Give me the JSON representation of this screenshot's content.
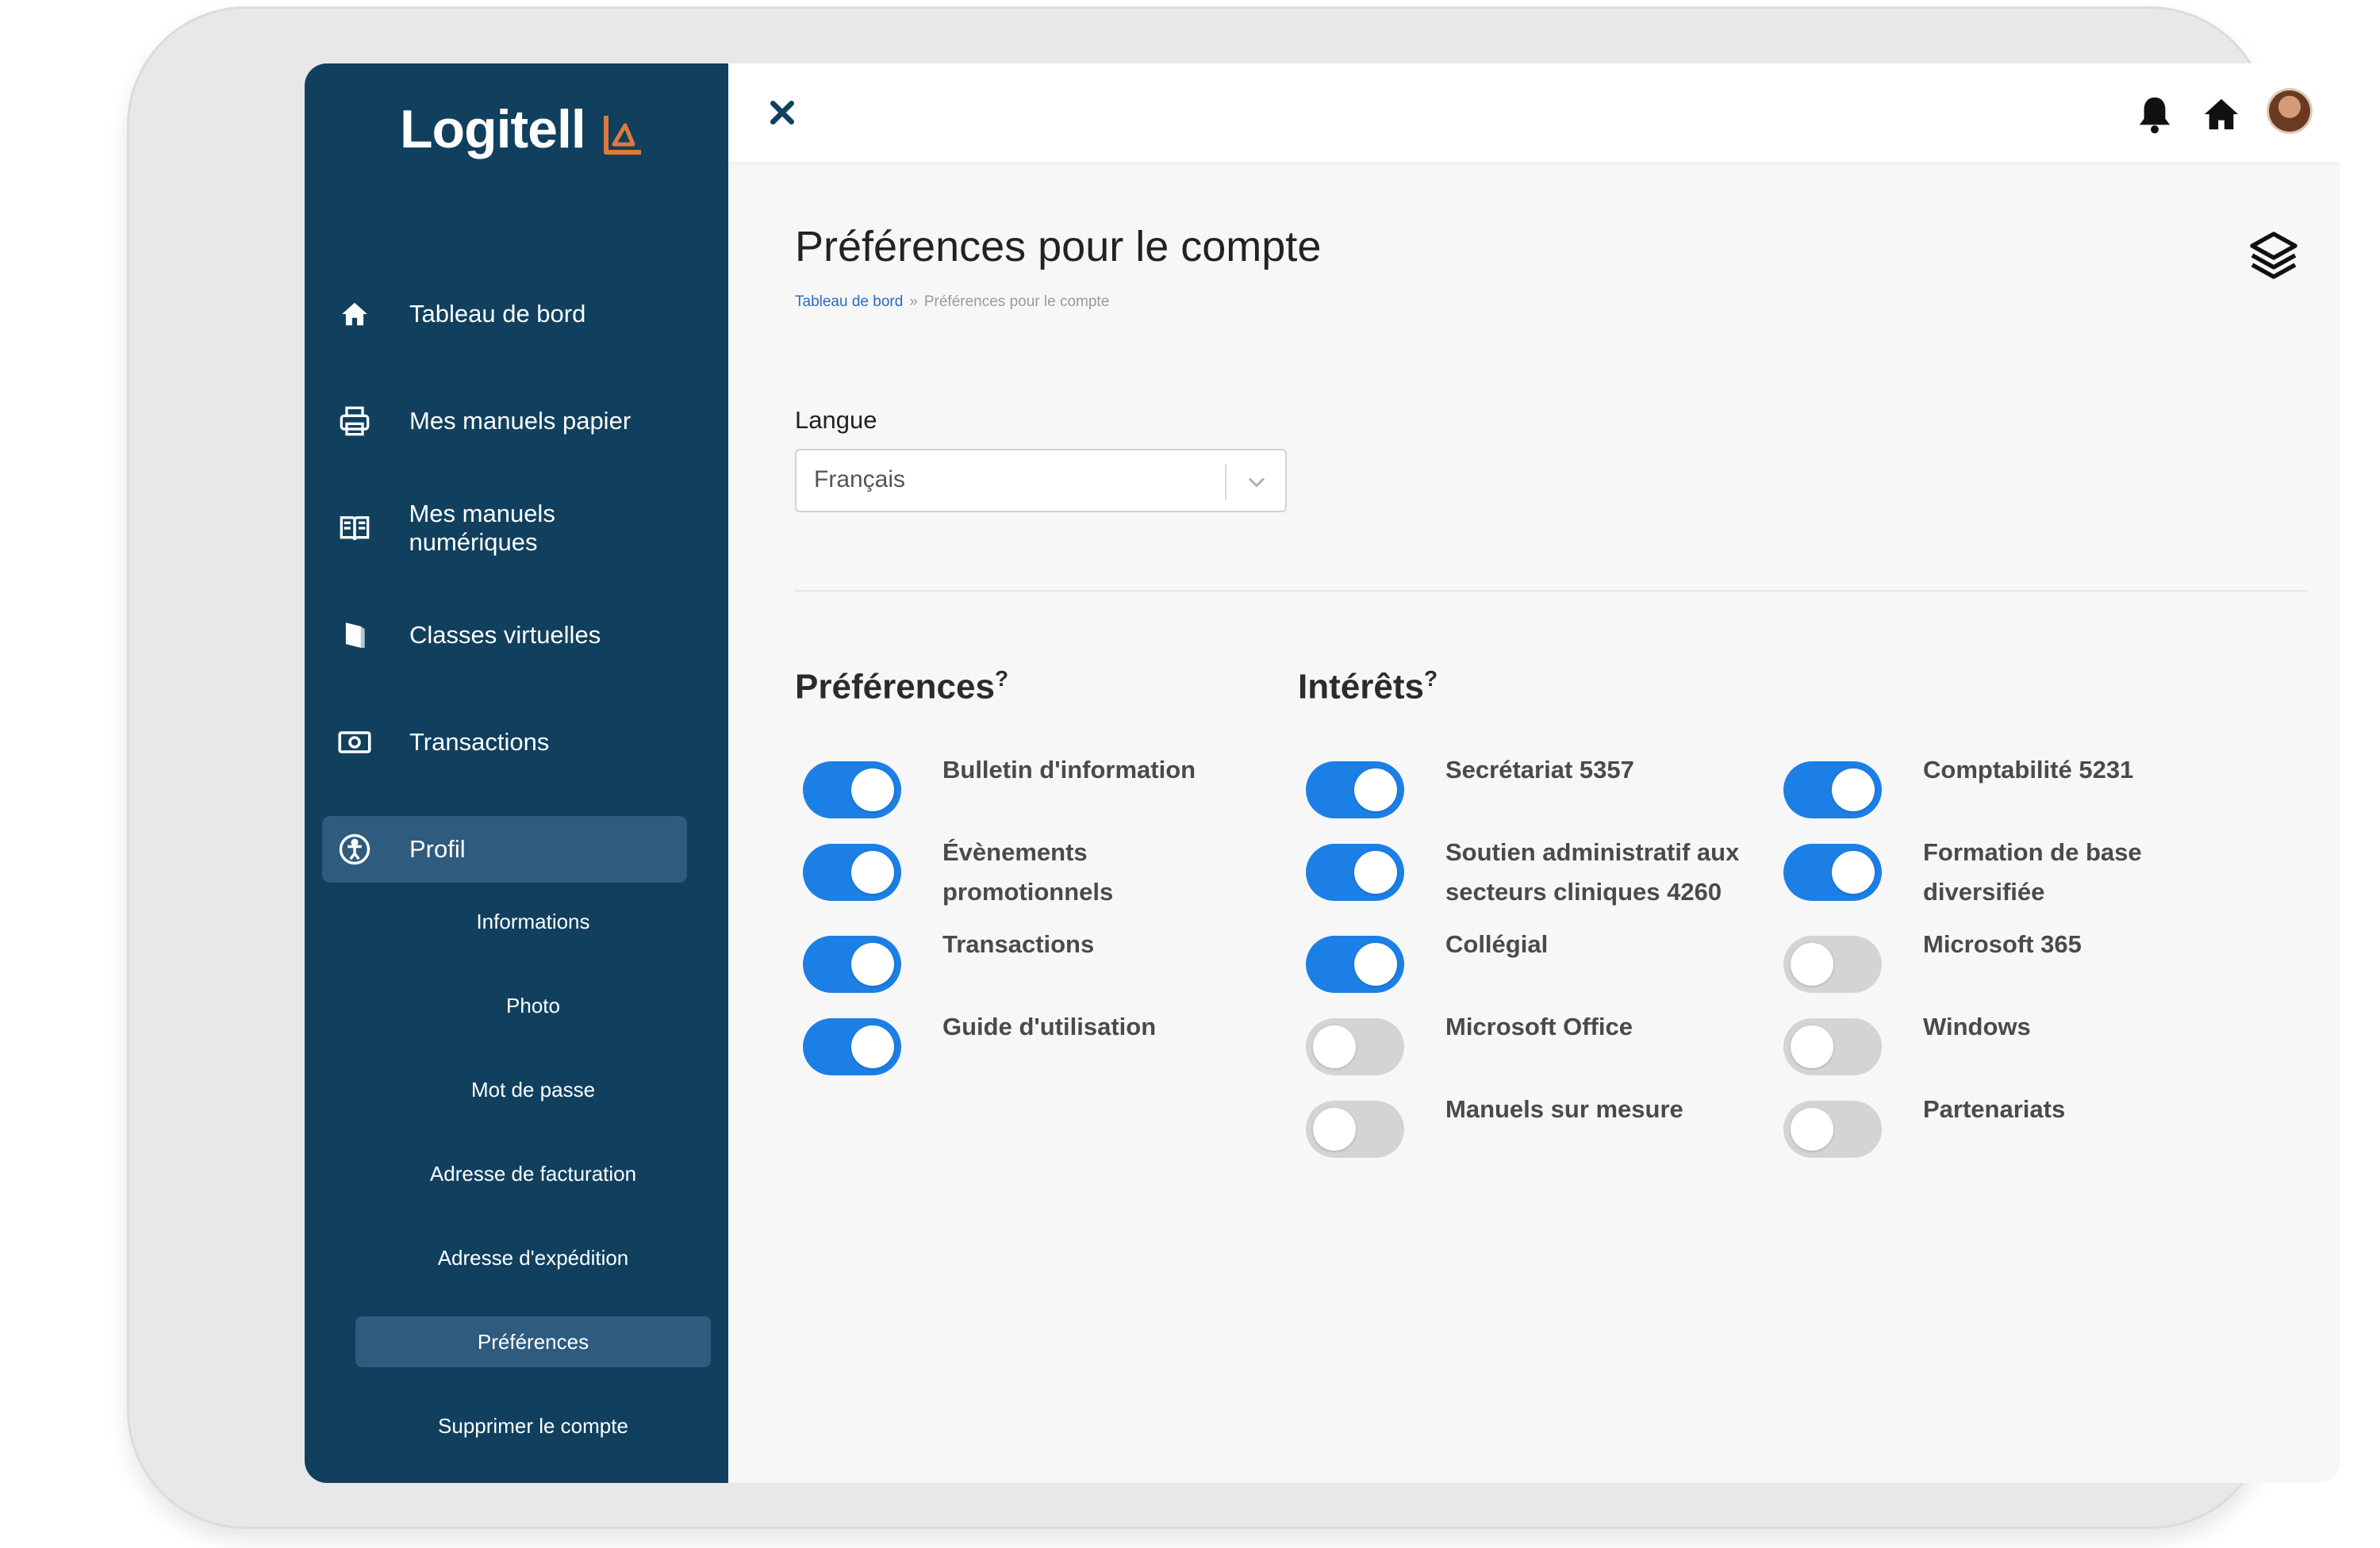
{
  "brand": {
    "name": "Logitell",
    "accent": "#e07a3a",
    "sidebar_bg": "#10405e",
    "toggle_on": "#1c7fe6"
  },
  "sidebar": {
    "items": [
      {
        "label": "Tableau de bord",
        "icon": "home-icon"
      },
      {
        "label": "Mes manuels papier",
        "icon": "printer-icon"
      },
      {
        "label": "Mes manuels numériques",
        "icon": "open-book-icon"
      },
      {
        "label": "Classes virtuelles",
        "icon": "virtual-class-icon"
      },
      {
        "label": "Transactions",
        "icon": "money-icon"
      },
      {
        "label": "Profil",
        "icon": "person-icon",
        "active": true
      }
    ],
    "subitems": [
      {
        "label": "Informations"
      },
      {
        "label": "Photo"
      },
      {
        "label": "Mot de passe"
      },
      {
        "label": "Adresse de facturation"
      },
      {
        "label": "Adresse d'expédition"
      },
      {
        "label": "Préférences",
        "active": true
      },
      {
        "label": "Supprimer le compte"
      }
    ]
  },
  "topbar": {
    "icons": [
      "close-icon",
      "bell-icon",
      "home-icon",
      "avatar"
    ]
  },
  "page": {
    "title": "Préférences pour le compte",
    "breadcrumb": {
      "home": "Tableau de bord",
      "separator": "»",
      "current": "Préférences pour le compte"
    }
  },
  "language": {
    "label": "Langue",
    "selected": "Français"
  },
  "preferences": {
    "title": "Préférences",
    "help": "?",
    "options": [
      {
        "label": "Bulletin d'information",
        "on": true
      },
      {
        "label": "Évènements promotionnels",
        "on": true
      },
      {
        "label": "Transactions",
        "on": true
      },
      {
        "label": "Guide d'utilisation",
        "on": true
      }
    ]
  },
  "interests": {
    "title": "Intérêts",
    "help": "?",
    "col1": [
      {
        "label": "Secrétariat 5357",
        "on": true
      },
      {
        "label": "Soutien administratif aux secteurs cliniques 4260",
        "on": true
      },
      {
        "label": "Collégial",
        "on": true
      },
      {
        "label": "Microsoft Office",
        "on": false
      },
      {
        "label": "Manuels sur mesure",
        "on": false
      }
    ],
    "col2": [
      {
        "label": "Comptabilité 5231",
        "on": true
      },
      {
        "label": "Formation de base diversifiée",
        "on": true
      },
      {
        "label": "Microsoft 365",
        "on": false
      },
      {
        "label": "Windows",
        "on": false
      },
      {
        "label": "Partenariats",
        "on": false
      }
    ]
  }
}
